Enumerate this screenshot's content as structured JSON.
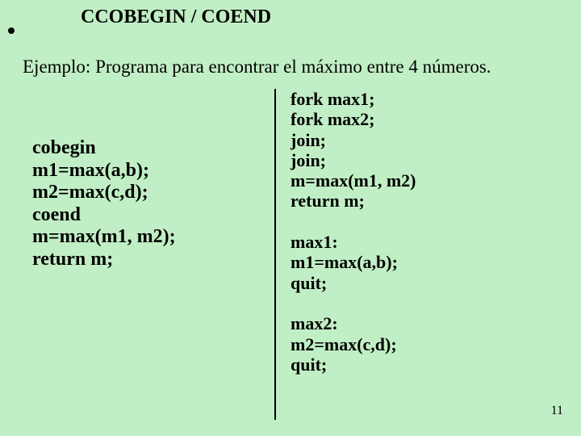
{
  "title": "CCOBEGIN / COEND",
  "example_text": "Ejemplo: Programa para encontrar el máximo entre 4 números.",
  "left_code": "cobegin\nm1=max(a,b);\nm2=max(c,d);\ncoend\nm=max(m1, m2);\nreturn m;",
  "right_code": "fork max1;\nfork max2;\njoin;\njoin;\nm=max(m1, m2)\nreturn m;\n\nmax1:\nm1=max(a,b);\nquit;\n\nmax2:\nm2=max(c,d);\nquit;",
  "page_number": "11"
}
